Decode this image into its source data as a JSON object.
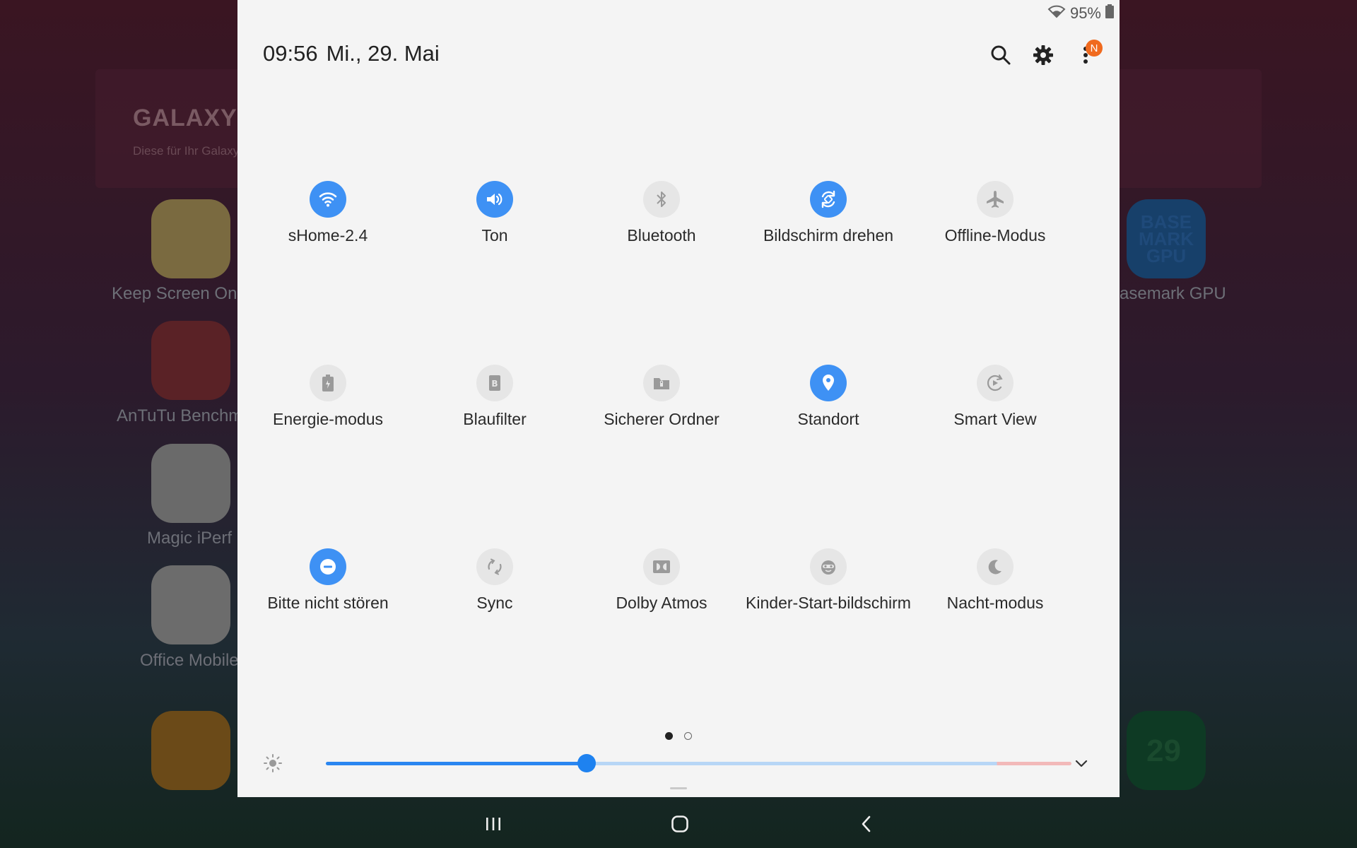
{
  "background": {
    "banner_title": "GALAXY E",
    "banner_subtitle": "Diese für Ihr Galaxy e",
    "apps_left": [
      {
        "label": "Keep Screen On"
      },
      {
        "label": "AnTuTu Benchm"
      },
      {
        "label": "Magic iPerf"
      },
      {
        "label": "Office Mobile"
      }
    ],
    "apps_right": [
      {
        "label": "asemark GPU",
        "icon_text": "BASE MARK GPU"
      }
    ],
    "calendar_day": "29"
  },
  "status_bar": {
    "battery": "95%",
    "wifi_icon": "wifi-icon",
    "battery_icon": "battery-icon"
  },
  "header": {
    "time": "09:56",
    "date": "Mi., 29. Mai",
    "notification_badge": "N"
  },
  "tiles": [
    {
      "label": "sHome-2.4",
      "state": "on",
      "icon": "wifi-icon"
    },
    {
      "label": "Ton",
      "state": "on",
      "icon": "sound-icon"
    },
    {
      "label": "Bluetooth",
      "state": "off",
      "icon": "bluetooth-icon"
    },
    {
      "label": "Bildschirm drehen",
      "state": "on",
      "icon": "rotate-icon"
    },
    {
      "label": "Offline-Modus",
      "state": "off",
      "icon": "airplane-icon"
    },
    {
      "label": "Energie-modus",
      "state": "off",
      "icon": "battery-eco-icon"
    },
    {
      "label": "Blaufilter",
      "state": "off",
      "icon": "blue-filter-icon"
    },
    {
      "label": "Sicherer Ordner",
      "state": "off",
      "icon": "secure-folder-icon"
    },
    {
      "label": "Standort",
      "state": "on",
      "icon": "location-icon"
    },
    {
      "label": "Smart View",
      "state": "off",
      "icon": "smart-view-icon"
    },
    {
      "label": "Bitte nicht stören",
      "state": "on",
      "icon": "do-not-disturb-icon"
    },
    {
      "label": "Sync",
      "state": "off",
      "icon": "sync-icon"
    },
    {
      "label": "Dolby Atmos",
      "state": "off",
      "icon": "dolby-icon"
    },
    {
      "label": "Kinder-Start-bildschirm",
      "state": "off",
      "icon": "kids-icon"
    },
    {
      "label": "Nacht-modus",
      "state": "off",
      "icon": "moon-icon"
    }
  ],
  "pager": {
    "pages": 2,
    "current": 1
  },
  "brightness": {
    "level": 0.35
  },
  "colors": {
    "accent": "#3e91f4",
    "tile_off": "#e6e6e6",
    "panel": "#f4f4f4"
  }
}
